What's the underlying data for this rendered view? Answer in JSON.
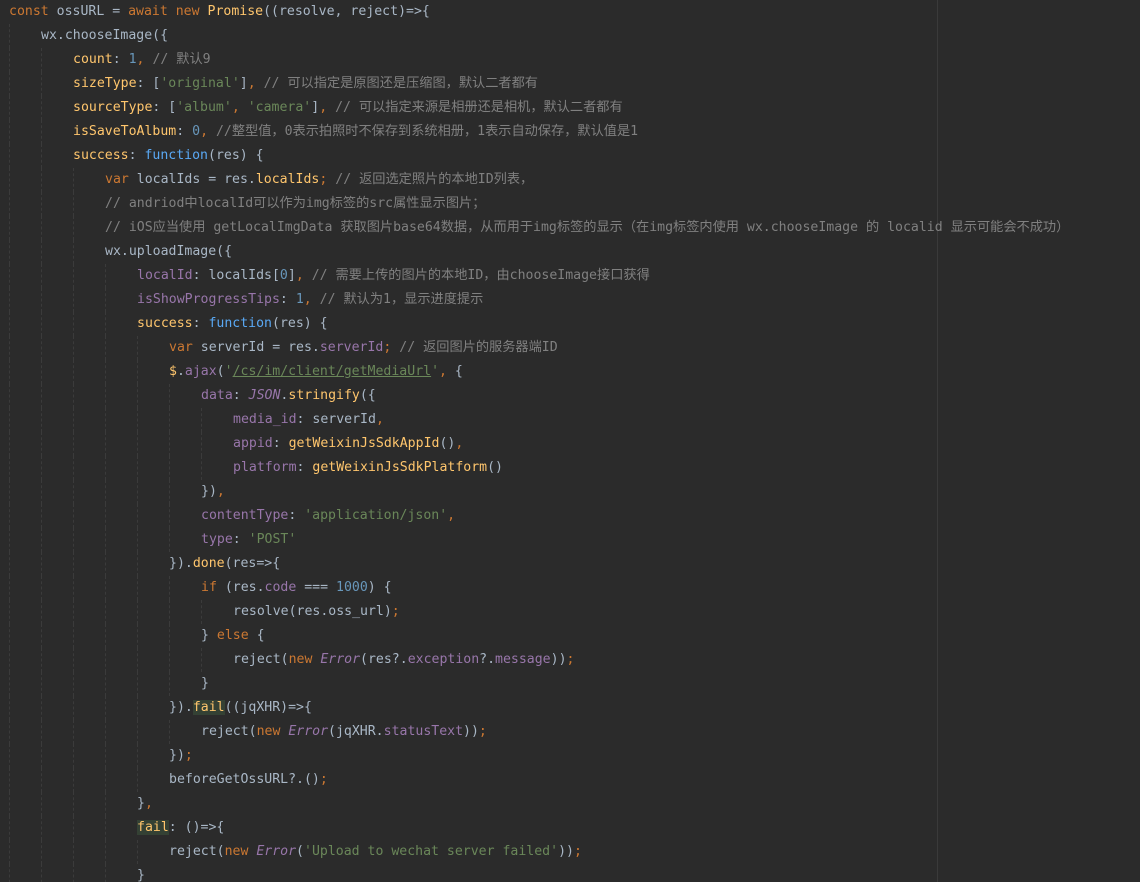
{
  "editor": {
    "colors": {
      "background": "#2b2b2b",
      "keyword": "#cc7832",
      "identifier": "#a9b7c6",
      "function": "#ffc66d",
      "property": "#9876aa",
      "string": "#6a8759",
      "number": "#6897bb",
      "comment": "#808080",
      "function_keyword": "#5aa9f5",
      "highlight_bg": "#344134"
    },
    "lines": [
      {
        "indent": 0,
        "tokens": [
          [
            "kw",
            "const "
          ],
          [
            "var",
            "ossURL = "
          ],
          [
            "kw",
            "await new "
          ],
          [
            "fn",
            "Promise"
          ],
          [
            "var",
            "((resolve, reject)=>{"
          ]
        ]
      },
      {
        "indent": 1,
        "tokens": [
          [
            "var",
            "wx.chooseImage({"
          ]
        ]
      },
      {
        "indent": 2,
        "tokens": [
          [
            "fn",
            "count"
          ],
          [
            "var",
            ": "
          ],
          [
            "num",
            "1"
          ],
          [
            "punc",
            ", "
          ],
          [
            "com",
            "// 默认9"
          ]
        ]
      },
      {
        "indent": 2,
        "tokens": [
          [
            "fn",
            "sizeType"
          ],
          [
            "var",
            ": ["
          ],
          [
            "str",
            "'original'"
          ],
          [
            "var",
            "]"
          ],
          [
            "punc",
            ", "
          ],
          [
            "com",
            "// 可以指定是原图还是压缩图，默认二者都有"
          ]
        ]
      },
      {
        "indent": 2,
        "tokens": [
          [
            "fn",
            "sourceType"
          ],
          [
            "var",
            ": ["
          ],
          [
            "str",
            "'album'"
          ],
          [
            "punc",
            ", "
          ],
          [
            "str",
            "'camera'"
          ],
          [
            "var",
            "]"
          ],
          [
            "punc",
            ", "
          ],
          [
            "com",
            "// 可以指定来源是相册还是相机，默认二者都有"
          ]
        ]
      },
      {
        "indent": 2,
        "tokens": [
          [
            "fn",
            "isSaveToAlbum"
          ],
          [
            "var",
            ": "
          ],
          [
            "num",
            "0"
          ],
          [
            "punc",
            ", "
          ],
          [
            "com",
            "//整型值，0表示拍照时不保存到系统相册，1表示自动保存，默认值是1"
          ]
        ]
      },
      {
        "indent": 2,
        "tokens": [
          [
            "fn",
            "success"
          ],
          [
            "var",
            ": "
          ],
          [
            "fnkw",
            "function"
          ],
          [
            "var",
            "(res) {"
          ]
        ]
      },
      {
        "indent": 3,
        "tokens": [
          [
            "kw",
            "var "
          ],
          [
            "var",
            "localIds = res."
          ],
          [
            "fn",
            "localIds"
          ],
          [
            "punc",
            "; "
          ],
          [
            "com",
            "// 返回选定照片的本地ID列表，"
          ]
        ]
      },
      {
        "indent": 3,
        "tokens": [
          [
            "com",
            "// andriod中localId可以作为img标签的src属性显示图片；"
          ]
        ]
      },
      {
        "indent": 3,
        "tokens": [
          [
            "com",
            "// iOS应当使用 getLocalImgData 获取图片base64数据，从而用于img标签的显示（在img标签内使用 wx.chooseImage 的 localid 显示可能会不成功）"
          ]
        ]
      },
      {
        "indent": 3,
        "tokens": [
          [
            "var",
            "wx.uploadImage({"
          ]
        ]
      },
      {
        "indent": 4,
        "tokens": [
          [
            "prop",
            "localId"
          ],
          [
            "var",
            ": localIds["
          ],
          [
            "num",
            "0"
          ],
          [
            "var",
            "]"
          ],
          [
            "punc",
            ", "
          ],
          [
            "com",
            "// 需要上传的图片的本地ID，由chooseImage接口获得"
          ]
        ]
      },
      {
        "indent": 4,
        "tokens": [
          [
            "prop",
            "isShowProgressTips"
          ],
          [
            "var",
            ": "
          ],
          [
            "num",
            "1"
          ],
          [
            "punc",
            ", "
          ],
          [
            "com",
            "// 默认为1，显示进度提示"
          ]
        ]
      },
      {
        "indent": 4,
        "tokens": [
          [
            "fn",
            "success"
          ],
          [
            "var",
            ": "
          ],
          [
            "fnkw",
            "function"
          ],
          [
            "var",
            "(res) {"
          ]
        ]
      },
      {
        "indent": 5,
        "tokens": [
          [
            "kw",
            "var "
          ],
          [
            "var",
            "serverId = res."
          ],
          [
            "prop",
            "serverId"
          ],
          [
            "punc",
            "; "
          ],
          [
            "com",
            "// 返回图片的服务器端ID"
          ]
        ]
      },
      {
        "indent": 5,
        "tokens": [
          [
            "fn",
            "$"
          ],
          [
            "var",
            "."
          ],
          [
            "prop",
            "ajax"
          ],
          [
            "var",
            "("
          ],
          [
            "str",
            "'"
          ],
          [
            "url",
            "/cs/im/client/getMediaUrl"
          ],
          [
            "str",
            "'"
          ],
          [
            "punc",
            ", "
          ],
          [
            "var",
            "{"
          ]
        ]
      },
      {
        "indent": 6,
        "tokens": [
          [
            "prop",
            "data"
          ],
          [
            "var",
            ": "
          ],
          [
            "cls",
            "JSON"
          ],
          [
            "var",
            "."
          ],
          [
            "fn",
            "stringify"
          ],
          [
            "var",
            "({"
          ]
        ]
      },
      {
        "indent": 7,
        "tokens": [
          [
            "prop",
            "media_id"
          ],
          [
            "var",
            ": serverId"
          ],
          [
            "punc",
            ","
          ]
        ]
      },
      {
        "indent": 7,
        "tokens": [
          [
            "prop",
            "appid"
          ],
          [
            "var",
            ": "
          ],
          [
            "fn",
            "getWeixinJsSdkAppId"
          ],
          [
            "var",
            "()"
          ],
          [
            "punc",
            ","
          ]
        ]
      },
      {
        "indent": 7,
        "tokens": [
          [
            "prop",
            "platform"
          ],
          [
            "var",
            ": "
          ],
          [
            "fn",
            "getWeixinJsSdkPlatform"
          ],
          [
            "var",
            "()"
          ]
        ]
      },
      {
        "indent": 6,
        "tokens": [
          [
            "var",
            "})"
          ],
          [
            "punc",
            ","
          ]
        ]
      },
      {
        "indent": 6,
        "tokens": [
          [
            "prop",
            "contentType"
          ],
          [
            "var",
            ": "
          ],
          [
            "str",
            "'application/json'"
          ],
          [
            "punc",
            ","
          ]
        ]
      },
      {
        "indent": 6,
        "tokens": [
          [
            "prop",
            "type"
          ],
          [
            "var",
            ": "
          ],
          [
            "str",
            "'POST'"
          ]
        ]
      },
      {
        "indent": 5,
        "tokens": [
          [
            "var",
            "})."
          ],
          [
            "fn",
            "done"
          ],
          [
            "var",
            "(res=>{"
          ]
        ]
      },
      {
        "indent": 6,
        "tokens": [
          [
            "kw",
            "if "
          ],
          [
            "var",
            "(res."
          ],
          [
            "prop",
            "code"
          ],
          [
            "var",
            " === "
          ],
          [
            "num",
            "1000"
          ],
          [
            "var",
            ") {"
          ]
        ]
      },
      {
        "indent": 7,
        "tokens": [
          [
            "var",
            "resolve(res.oss_url)"
          ],
          [
            "punc",
            ";"
          ]
        ]
      },
      {
        "indent": 6,
        "tokens": [
          [
            "var",
            "} "
          ],
          [
            "kw",
            "else "
          ],
          [
            "var",
            "{"
          ]
        ]
      },
      {
        "indent": 7,
        "tokens": [
          [
            "var",
            "reject("
          ],
          [
            "kw",
            "new "
          ],
          [
            "cls",
            "Error"
          ],
          [
            "var",
            "(res?."
          ],
          [
            "prop",
            "exception"
          ],
          [
            "var",
            "?."
          ],
          [
            "prop",
            "message"
          ],
          [
            "var",
            "))"
          ],
          [
            "punc",
            ";"
          ]
        ]
      },
      {
        "indent": 6,
        "tokens": [
          [
            "var",
            "}"
          ]
        ]
      },
      {
        "indent": 5,
        "tokens": [
          [
            "var",
            "})."
          ],
          [
            "mark",
            "fail"
          ],
          [
            "var",
            "((jqXHR)=>{"
          ]
        ]
      },
      {
        "indent": 6,
        "tokens": [
          [
            "var",
            "reject("
          ],
          [
            "kw",
            "new "
          ],
          [
            "cls",
            "Error"
          ],
          [
            "var",
            "(jqXHR."
          ],
          [
            "prop",
            "statusText"
          ],
          [
            "var",
            "))"
          ],
          [
            "punc",
            ";"
          ]
        ]
      },
      {
        "indent": 5,
        "tokens": [
          [
            "var",
            "})"
          ],
          [
            "punc",
            ";"
          ]
        ]
      },
      {
        "indent": 5,
        "tokens": [
          [
            "var",
            "beforeGetOssURL?.()"
          ],
          [
            "punc",
            ";"
          ]
        ]
      },
      {
        "indent": 4,
        "tokens": [
          [
            "var",
            "}"
          ],
          [
            "punc",
            ","
          ]
        ]
      },
      {
        "indent": 4,
        "tokens": [
          [
            "mark",
            "fail"
          ],
          [
            "var",
            ": ()=>{"
          ]
        ]
      },
      {
        "indent": 5,
        "tokens": [
          [
            "var",
            "reject("
          ],
          [
            "kw",
            "new "
          ],
          [
            "cls",
            "Error"
          ],
          [
            "var",
            "("
          ],
          [
            "str",
            "'Upload to wechat server failed'"
          ],
          [
            "var",
            "))"
          ],
          [
            "punc",
            ";"
          ]
        ]
      },
      {
        "indent": 4,
        "tokens": [
          [
            "var",
            "}"
          ]
        ]
      }
    ]
  }
}
